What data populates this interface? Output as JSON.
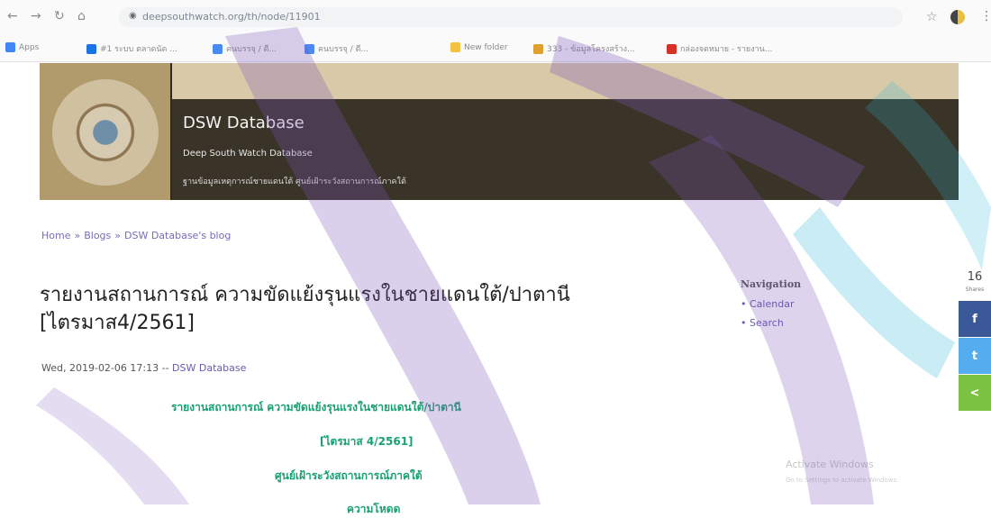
{
  "browser": {
    "url": "deepsouthwatch.org/th/node/11901",
    "bookmarks": [
      "Apps",
      "#1 ระบบ ตลาดนัด ...",
      "คนบรรจุ / ดี...",
      "คนบรรจุ / ดี...",
      "New folder",
      "333 - ข้อมูลโครงสร้าง...",
      "กล่องจดหมาย - รายงาน..."
    ]
  },
  "site": {
    "name": "DSW Database",
    "slogan": "Deep South Watch Database",
    "thai_slogan": "ฐานข้อมูลเหตุการณ์ชายแดนใต้ ศูนย์เฝ้าระวังสถานการณ์ภาคใต้"
  },
  "breadcrumb": {
    "items": [
      "Home",
      "Blogs",
      "DSW Database's blog"
    ],
    "separator": "»"
  },
  "article": {
    "title": "รายงานสถานการณ์ ความขัดแย้งรุนแรงในชายแดนใต้/ปาตานี [ไตรมาส4/2561]",
    "date": "Wed, 2019-02-06 17:13 --",
    "author": "DSW Database",
    "body": [
      "รายงานสถานการณ์ ความขัดแย้งรุนแรงในชายแดนใต้/ปาตานี",
      "[ไตรมาส 4/2561]",
      "ศูนย์เฝ้าระวังสถานการณ์ภาคใต้",
      "ความโหดด"
    ]
  },
  "sidebar": {
    "heading": "Navigation",
    "items": [
      "Calendar",
      "Search"
    ]
  },
  "share": {
    "count": "16",
    "label": "Shares",
    "buttons": [
      {
        "name": "facebook",
        "glyph": "f",
        "color": "#3b5998"
      },
      {
        "name": "twitter",
        "glyph": "t",
        "color": "#55acee"
      },
      {
        "name": "share",
        "glyph": "<",
        "color": "#7cc242"
      }
    ]
  },
  "system": {
    "activate_title": "Activate Windows",
    "activate_sub": "Go to Settings to activate Windows."
  }
}
